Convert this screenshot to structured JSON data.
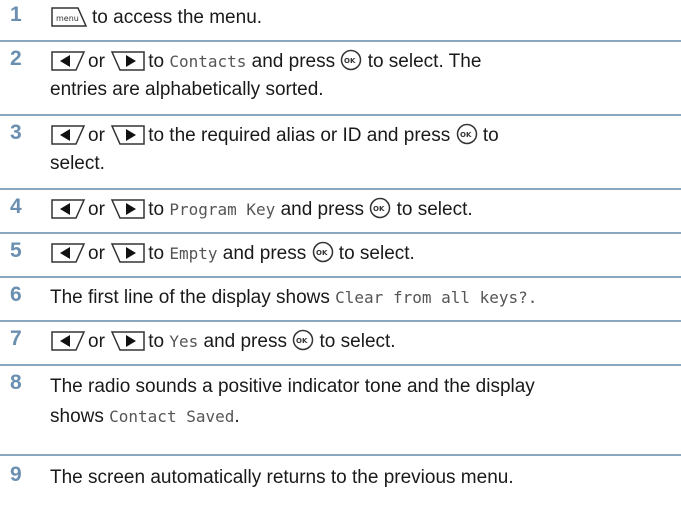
{
  "steps": [
    {
      "num": "1",
      "text": "to access the menu."
    },
    {
      "num": "2",
      "or": "or",
      "t1": "to",
      "code": "Contacts",
      "t2": "and press",
      "t3": "to select. The",
      "line2": "entries are alphabetically sorted."
    },
    {
      "num": "3",
      "or": "or",
      "t1": "to the required alias or ID and press",
      "t3": "to",
      "line2": "select."
    },
    {
      "num": "4",
      "or": "or",
      "t1": "to",
      "code": "Program Key",
      "t2": "and press",
      "t3": "to select."
    },
    {
      "num": "5",
      "or": "or",
      "t1": "to",
      "code": "Empty",
      "t2": "and press",
      "t3": "to select."
    },
    {
      "num": "6",
      "t1": "The first line of the display shows",
      "code": "Clear from all keys?."
    },
    {
      "num": "7",
      "or": "or",
      "t1": "to",
      "code": "Yes",
      "t2": "and press",
      "t3": "to select."
    },
    {
      "num": "8",
      "t1": "The radio sounds a positive indicator tone and the display",
      "line2a": "shows",
      "code": "Contact Saved",
      "line2b": "."
    },
    {
      "num": "9",
      "t1": "The screen automatically returns to the previous menu."
    }
  ],
  "icons": {
    "menu_key_label": "menu",
    "ok_label": "OK"
  },
  "colors": {
    "step_number": "#6b8fb0",
    "divider": "#8aa7bf"
  }
}
